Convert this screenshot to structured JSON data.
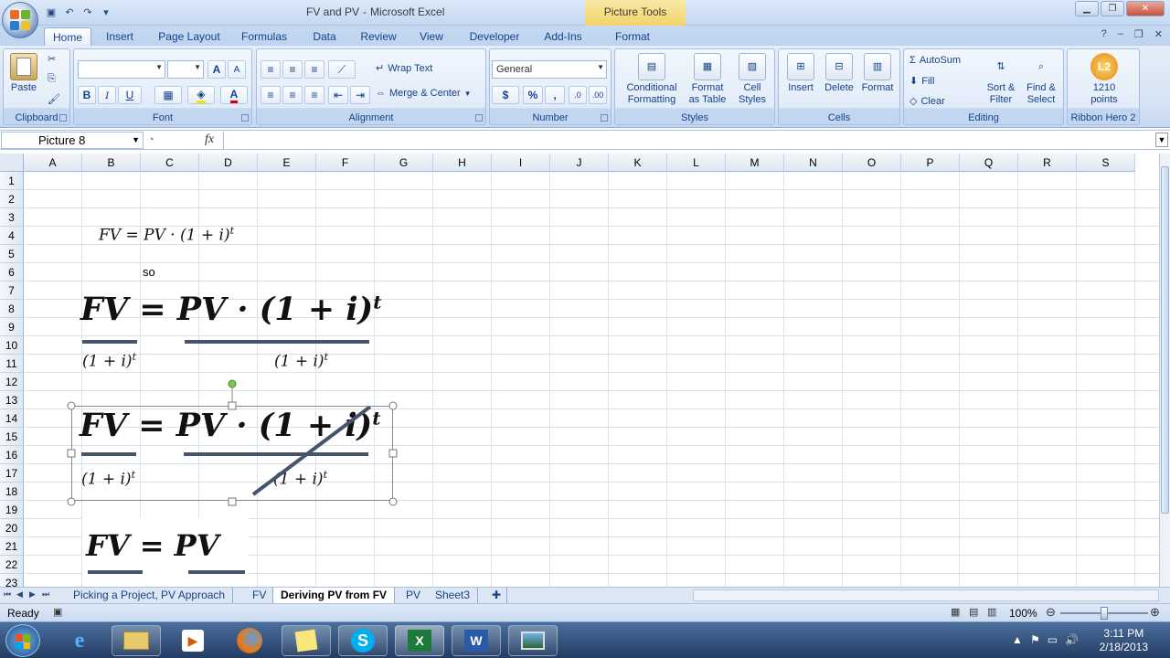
{
  "titlebar": {
    "doc_name": "FV and PV",
    "separator": "-",
    "app_name": "Microsoft Excel",
    "context_tools": "Picture Tools"
  },
  "tabs": [
    {
      "label": "Home",
      "active": true
    },
    {
      "label": "Insert"
    },
    {
      "label": "Page Layout"
    },
    {
      "label": "Formulas"
    },
    {
      "label": "Data"
    },
    {
      "label": "Review"
    },
    {
      "label": "View"
    },
    {
      "label": "Developer"
    },
    {
      "label": "Add-Ins"
    },
    {
      "label": "Format"
    }
  ],
  "ribbon": {
    "clipboard": {
      "label": "Clipboard",
      "paste": "Paste"
    },
    "font": {
      "label": "Font",
      "bold": "B",
      "italic": "I",
      "underline": "U",
      "grow": "A",
      "shrink": "A",
      "font_color": "A"
    },
    "alignment": {
      "label": "Alignment",
      "wrap_text": "Wrap Text",
      "merge_center": "Merge & Center"
    },
    "number": {
      "label": "Number",
      "format": "General",
      "currency": "$",
      "percent": "%",
      "comma": ","
    },
    "styles": {
      "label": "Styles",
      "conditional_1": "Conditional",
      "conditional_2": "Formatting",
      "format_table_1": "Format",
      "format_table_2": "as Table",
      "cell_styles_1": "Cell",
      "cell_styles_2": "Styles"
    },
    "cells": {
      "label": "Cells",
      "insert": "Insert",
      "delete": "Delete",
      "format": "Format"
    },
    "editing": {
      "label": "Editing",
      "autosum": "AutoSum",
      "fill": "Fill",
      "clear": "Clear",
      "sort_1": "Sort &",
      "sort_2": "Filter",
      "find_1": "Find &",
      "find_2": "Select"
    },
    "ribbon_hero": {
      "label": "Ribbon Hero 2",
      "badge": "L2",
      "points_1": "1210",
      "points_2": "points"
    }
  },
  "formula_bar": {
    "name_box": "Picture 8",
    "fx": "fx",
    "content": ""
  },
  "columns": [
    "A",
    "B",
    "C",
    "D",
    "E",
    "F",
    "G",
    "H",
    "I",
    "J",
    "K",
    "L",
    "M",
    "N",
    "O",
    "P",
    "Q",
    "R",
    "S"
  ],
  "rows": [
    "1",
    "2",
    "3",
    "4",
    "5",
    "6",
    "7",
    "8",
    "9",
    "10",
    "11",
    "12",
    "13",
    "14",
    "15",
    "16",
    "17",
    "18",
    "19",
    "20",
    "21",
    "22",
    "23"
  ],
  "cells": {
    "c6": "so"
  },
  "equations": {
    "eq1": "FV = PV · (1 + i)",
    "eq1_sup": "t",
    "eq2_main": "FV = PV · (1 + i)",
    "eq2_sup": "t",
    "eq2_den_left": "(1 + i)",
    "eq2_den_right": "(1 + i)",
    "eq2_den_sup": "t",
    "eq3_main": "FV = PV · (1 + i)",
    "eq3_sup": "t",
    "eq3_den_left": "(1 + i)",
    "eq3_den_right": "(1 + i)",
    "eq3_den_sup": "t",
    "eq4": "FV = PV"
  },
  "sheet_tabs": [
    {
      "label": "Picking a Project, PV Approach"
    },
    {
      "label": "FV"
    },
    {
      "label": "Deriving PV from FV",
      "active": true
    },
    {
      "label": "PV"
    },
    {
      "label": "Sheet3"
    }
  ],
  "status": {
    "ready": "Ready",
    "zoom": "100%",
    "zoom_level": 1.0
  },
  "taskbar": {
    "time": "3:11 PM",
    "date": "2/18/2013"
  },
  "colors": {
    "ribbon_bg": "#d7e4f5",
    "accent": "#15428b",
    "equation_bar": "#44546a",
    "context_tab": "#f3d46a"
  }
}
